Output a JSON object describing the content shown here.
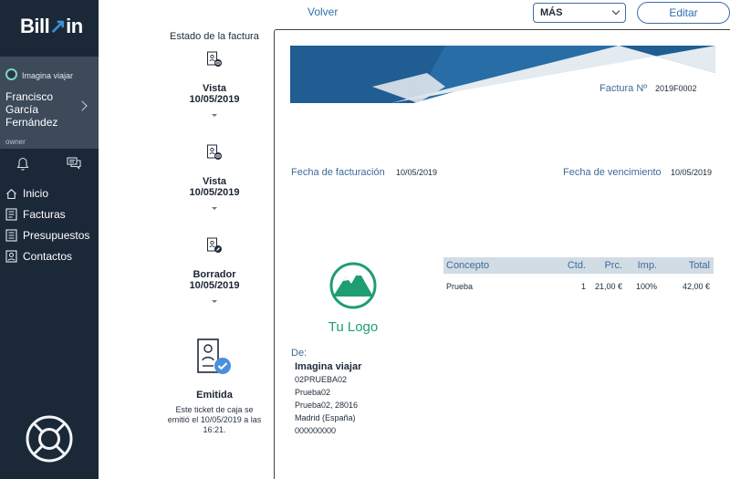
{
  "app": {
    "logo_text_a": "Bill",
    "logo_text_b": "in"
  },
  "user": {
    "company": "Imagina viajar",
    "name": "Francisco García Fernández",
    "role": "owner"
  },
  "nav": {
    "items": [
      {
        "label": "Inicio",
        "icon": "home-icon"
      },
      {
        "label": "Facturas",
        "icon": "invoice-icon"
      },
      {
        "label": "Presupuestos",
        "icon": "budget-icon"
      },
      {
        "label": "Contactos",
        "icon": "contacts-icon"
      }
    ]
  },
  "status": {
    "title": "Estado de la factura",
    "steps": [
      {
        "label": "Vista",
        "date": "10/05/2019",
        "icon": "document-eye-icon"
      },
      {
        "label": "Vista",
        "date": "10/05/2019",
        "icon": "document-eye-icon"
      },
      {
        "label": "Borrador",
        "date": "10/05/2019",
        "icon": "document-edit-icon"
      }
    ],
    "emitted": {
      "label": "Emitida",
      "text": "Este ticket de caja se emitió el 10/05/2019 a las 16:21.",
      "icon": "document-check-icon"
    }
  },
  "toolbar": {
    "back_label": "Volver",
    "more_label": "MÁS",
    "edit_label": "Editar"
  },
  "invoice": {
    "number_label": "Factura Nº",
    "number": "2019F0002",
    "billing_label": "Fecha de facturación",
    "billing_date": "10/05/2019",
    "due_label": "Fecha de vencimiento",
    "due_date": "10/05/2019",
    "logo_text": "Tu Logo",
    "columns": {
      "concept": "Concepto",
      "qty": "Ctd.",
      "price": "Prc.",
      "tax": "Imp.",
      "total": "Total"
    },
    "rows": [
      {
        "concept": "Prueba",
        "qty": "1",
        "price": "21,00 €",
        "tax": "100%",
        "total": "42,00 €"
      }
    ],
    "from": {
      "label": "De:",
      "name": "Imagina viajar",
      "lines": [
        "02PRUEBA02",
        "Prueba02",
        "Prueba02, 28016",
        "Madrid (España)",
        "000000000"
      ]
    }
  },
  "colors": {
    "sidebar": "#1b2838",
    "user_card": "#3c4a5a",
    "accent": "#2e6fb0",
    "logo_green": "#1f9d73",
    "banner_dark": "#1d5a8c",
    "banner_light": "#dfe6ec"
  }
}
